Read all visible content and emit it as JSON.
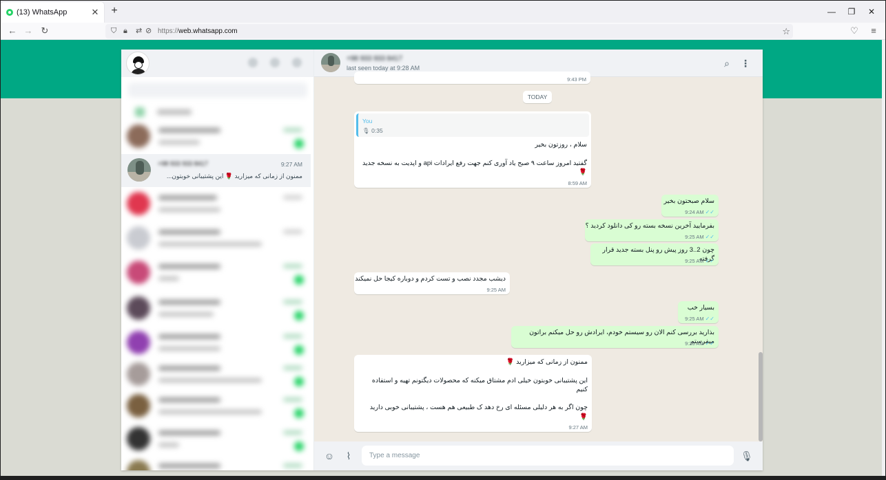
{
  "browser": {
    "tab_title": "(13) WhatsApp",
    "tab_close": "✕",
    "new_tab": "+",
    "url_prefix": "https://",
    "url_host": "web.whatsapp.com",
    "window_min": "—",
    "window_restore": "❐",
    "window_close": "✕"
  },
  "sidebar": {
    "active_chat": {
      "name": "+98 933 933 8417",
      "time": "9:27 AM",
      "preview": "ممنون از زمانی که میزارید 🌹 این پشتیبانی خوبتون..."
    }
  },
  "chat": {
    "contact_name": "+98 933 933 8417",
    "status": "last seen today at 9:28 AM",
    "prev_time": "9:43 PM",
    "date_divider": "TODAY",
    "messages": [
      {
        "dir": "in",
        "quote_sender": "You",
        "quote_text": "0:35",
        "text": "سلام ، روزتون بخیر\n\nگفتید امروز ساعت ۹ صبح یاد آوری کنم جهت رفع ایرادات api و اپدیت به نسخه جدید\n🌹",
        "time": "8:59 AM"
      },
      {
        "dir": "out",
        "text": "سلام صبحتون بخیر",
        "time": "9:24 AM"
      },
      {
        "dir": "out",
        "text": "بفرمایید آخرین نسخه بسته رو کی دانلود کردید ؟",
        "time": "9:25 AM"
      },
      {
        "dir": "out",
        "text": "چون 2..3 روز پیش رو پنل بسته جدید قرار گرفته",
        "time": "9:25 AM"
      },
      {
        "dir": "in",
        "text": "دیشب مجدد نصب و تست کردم و دوباره کیجا حل نمیکند",
        "time": "9:25 AM"
      },
      {
        "dir": "out",
        "text": "بسیار خب",
        "time": "9:25 AM"
      },
      {
        "dir": "out",
        "text": "بذارید بررسی کنم الان رو سیستم خودم، ایرادش رو حل میکنم براتون میفرستم",
        "time": "9:26 AM"
      },
      {
        "dir": "in",
        "text": "ممنون از زمانی که میزارید 🌹\n\nاین پشتیبانی خوبتون خیلی ادم مشتاق میکنه که محصولات دیگتونم تهیه و استفاده کنیم\n\nچون اگر به هر دلیلی مسئله ای رخ دهد ک طبیعی هم هست ، پشتیبانی خوبی دارید\n🌹",
        "time": "9:27 AM"
      }
    ],
    "tick_glyph": "✓✓"
  },
  "compose": {
    "placeholder": "Type a message"
  },
  "colors": {
    "accent": "#00a884",
    "outgoing": "#d9fdd3",
    "incoming": "#ffffff",
    "chat_bg": "#efeae2",
    "read_tick": "#53bdeb"
  },
  "icons": [
    "lock-icon",
    "shield-icon",
    "star-icon",
    "pocket-icon",
    "menu-icon",
    "search-icon",
    "more-icon",
    "emoji-icon",
    "attach-icon",
    "mic-icon",
    "mic-small-icon"
  ]
}
